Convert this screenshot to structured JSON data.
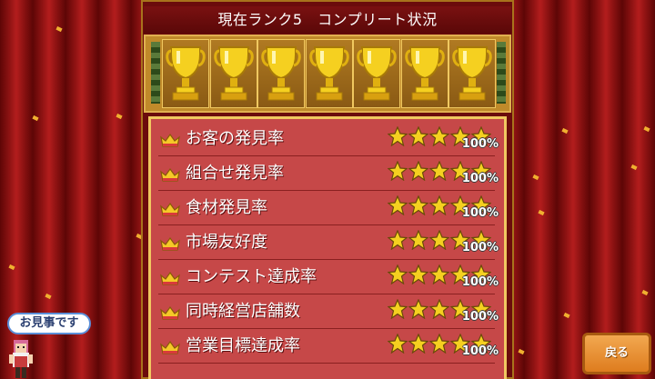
{
  "title": "現在ランク5　コンプリート状況",
  "trophy_count": 7,
  "stats": [
    {
      "label": "お客の発見率",
      "stars": 5,
      "percent": "100%"
    },
    {
      "label": "組合せ発見率",
      "stars": 5,
      "percent": "100%"
    },
    {
      "label": "食材発見率",
      "stars": 5,
      "percent": "100%"
    },
    {
      "label": "市場友好度",
      "stars": 5,
      "percent": "100%"
    },
    {
      "label": "コンテスト達成率",
      "stars": 5,
      "percent": "100%"
    },
    {
      "label": "同時経営店舗数",
      "stars": 5,
      "percent": "100%"
    },
    {
      "label": "営業目標達成率",
      "stars": 5,
      "percent": "100%"
    }
  ],
  "bubble_text": "お見事です",
  "back_label": "戻る",
  "colors": {
    "curtain": "#8c1212",
    "panel": "#c64848",
    "gold": "#f0c860",
    "star": "#f5d020",
    "button": "#e8902e"
  }
}
